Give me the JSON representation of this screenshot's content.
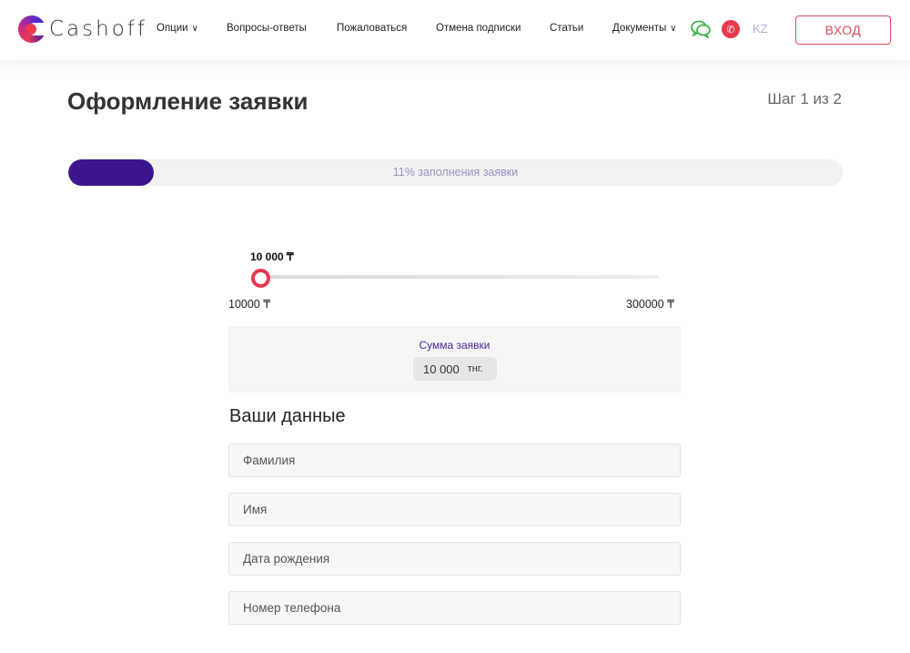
{
  "brand": {
    "name": "Cashoff"
  },
  "nav": {
    "items": [
      {
        "label": "Опции",
        "chevron": "∨"
      },
      {
        "label": "Вопросы-ответы"
      },
      {
        "label": "Пожаловаться"
      },
      {
        "label": "Отмена подписки"
      },
      {
        "label": "Статьи"
      },
      {
        "label": "Документы",
        "chevron": "∨"
      }
    ],
    "icons": [
      "chat-icon",
      "phone-icon"
    ],
    "lang": "KZ",
    "login_label": "ВХОД"
  },
  "page": {
    "title": "Оформление заявки",
    "step": "Шаг 1 из 2"
  },
  "progress": {
    "percent": 11,
    "label": "11% заполнения заявки"
  },
  "slider": {
    "value_label": "10 000 ₸",
    "value": 10000,
    "min_label": "10000 ₸",
    "max_label": "300000 ₸",
    "min": 10000,
    "max": 300000
  },
  "sum": {
    "label": "Сумма заявки",
    "value": "10 000",
    "currency": "тнг."
  },
  "form": {
    "section_title": "Ваши данные",
    "fields": [
      {
        "placeholder": "Фамилия"
      },
      {
        "placeholder": "Имя"
      },
      {
        "placeholder": "Дата рождения"
      },
      {
        "placeholder": "Номер телефона"
      }
    ]
  },
  "colors": {
    "accent": "#e8394f",
    "brand_purple": "#3d168f",
    "lang": "#b6b0dc"
  }
}
